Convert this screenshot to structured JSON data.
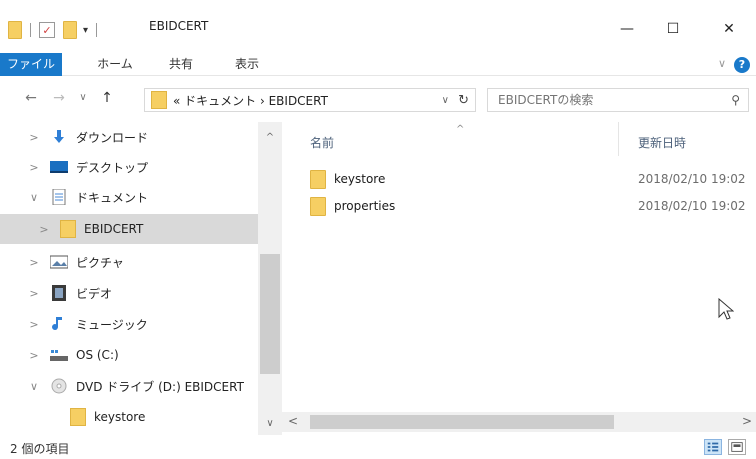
{
  "window": {
    "title": "EBIDCERT",
    "minimize": "—",
    "maximize": "☐",
    "close": "✕"
  },
  "ribbon": {
    "tabs": [
      {
        "label": "ファイル",
        "active": true
      },
      {
        "label": "ホーム",
        "active": false
      },
      {
        "label": "共有",
        "active": false
      },
      {
        "label": "表示",
        "active": false
      }
    ],
    "expand": "∨",
    "help": "?"
  },
  "address": {
    "back": "←",
    "forward": "→",
    "recent": "∨",
    "up": "↑",
    "path": "« ドキュメント › EBIDCERT",
    "dropdown": "∨",
    "refresh": "↻"
  },
  "search": {
    "placeholder": "EBIDCERTの検索",
    "icon": "⚲"
  },
  "nav_pane": {
    "items": [
      {
        "label": "ダウンロード",
        "chevron": ">",
        "icon": "download-icon"
      },
      {
        "label": "デスクトップ",
        "chevron": ">",
        "icon": "desktop-icon"
      },
      {
        "label": "ドキュメント",
        "chevron": "∨",
        "icon": "documents-icon"
      },
      {
        "label": "EBIDCERT",
        "chevron": ">",
        "icon": "folder-icon",
        "selected": true
      },
      {
        "label": "ピクチャ",
        "chevron": ">",
        "icon": "pictures-icon"
      },
      {
        "label": "ビデオ",
        "chevron": ">",
        "icon": "videos-icon"
      },
      {
        "label": "ミュージック",
        "chevron": ">",
        "icon": "music-icon"
      },
      {
        "label": "OS (C:)",
        "chevron": ">",
        "icon": "drive-icon"
      },
      {
        "label": "DVD ドライブ (D:) EBIDCERT",
        "chevron": "∨",
        "icon": "dvd-icon"
      },
      {
        "label": "keystore",
        "chevron": "",
        "icon": "folder-icon"
      }
    ],
    "scroll_up": "^",
    "scroll_down": "∨"
  },
  "content": {
    "columns": {
      "name": "名前",
      "date": "更新日時",
      "sort_indicator": "^"
    },
    "files": [
      {
        "name": "keystore",
        "date": "2018/02/10 19:02"
      },
      {
        "name": "properties",
        "date": "2018/02/10 19:02"
      }
    ],
    "scroll_left": "<",
    "scroll_right": ">"
  },
  "status": {
    "item_count": "2 個の項目"
  },
  "colors": {
    "accent": "#1979ca",
    "folder": "#f6cf63",
    "selected_bg": "#d9d9d9"
  }
}
